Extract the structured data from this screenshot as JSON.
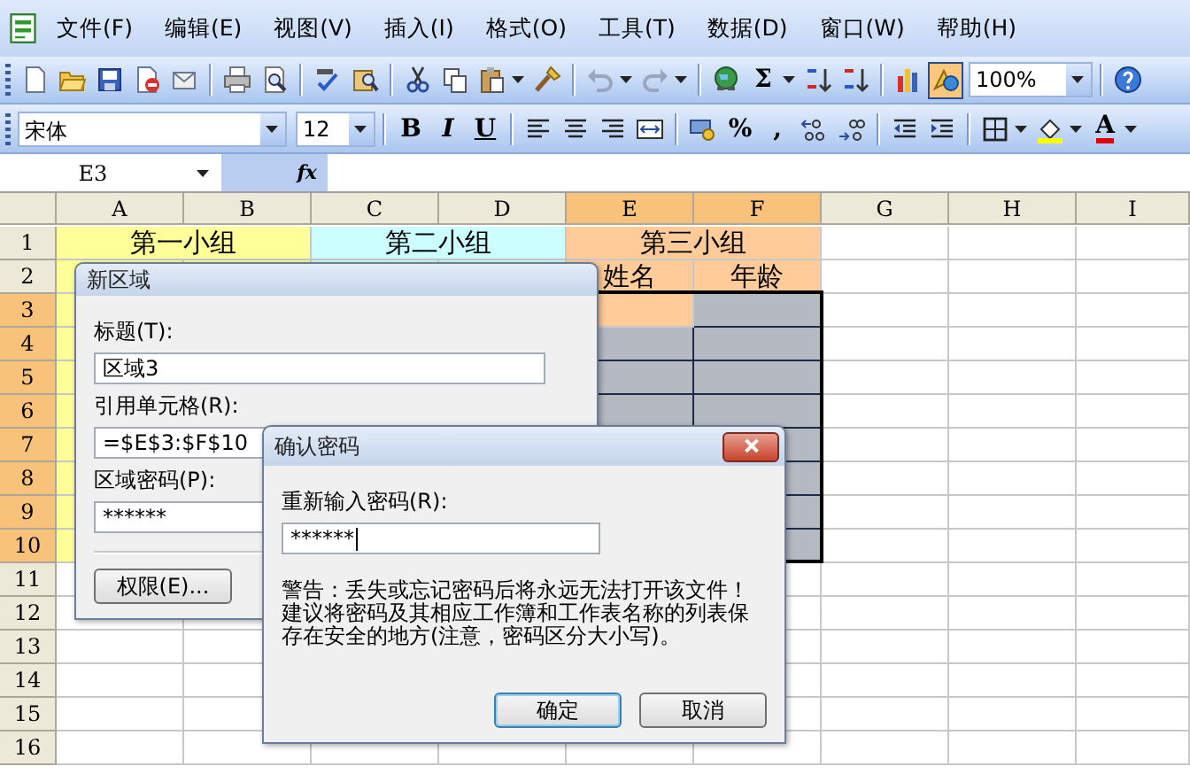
{
  "menu_bar": {
    "items": [
      {
        "label": "文件(F)"
      },
      {
        "label": "编辑(E)"
      },
      {
        "label": "视图(V)"
      },
      {
        "label": "插入(I)"
      },
      {
        "label": "格式(O)"
      },
      {
        "label": "工具(T)"
      },
      {
        "label": "数据(D)"
      },
      {
        "label": "窗口(W)"
      },
      {
        "label": "帮助(H)"
      }
    ]
  },
  "standard_toolbar": {
    "autosum": "Σ",
    "zoom": "100%",
    "drawing_on": true
  },
  "formatting_toolbar": {
    "font": "宋体",
    "size": "12",
    "bold": "B",
    "italic": "I",
    "underline": "U",
    "percent": "%",
    "comma": ",",
    "font_color_letter": "A"
  },
  "formula_bar": {
    "name_box": "E3",
    "function_label": "fx"
  },
  "sheet": {
    "columns": [
      {
        "label": "A",
        "selected": false
      },
      {
        "label": "B",
        "selected": false
      },
      {
        "label": "C",
        "selected": false
      },
      {
        "label": "D",
        "selected": false
      },
      {
        "label": "E",
        "selected": true
      },
      {
        "label": "F",
        "selected": true
      },
      {
        "label": "G",
        "selected": false
      },
      {
        "label": "H",
        "selected": false
      },
      {
        "label": "I",
        "selected": false
      }
    ],
    "rows": [
      {
        "label": "1",
        "selected": false,
        "in_table": true
      },
      {
        "label": "2",
        "selected": false,
        "in_table": true
      },
      {
        "label": "3",
        "selected": true,
        "in_table": true
      },
      {
        "label": "4",
        "selected": true,
        "in_table": true
      },
      {
        "label": "5",
        "selected": true,
        "in_table": true
      },
      {
        "label": "6",
        "selected": true,
        "in_table": true
      },
      {
        "label": "7",
        "selected": true,
        "in_table": true
      },
      {
        "label": "8",
        "selected": true,
        "in_table": true
      },
      {
        "label": "9",
        "selected": true,
        "in_table": true
      },
      {
        "label": "10",
        "selected": true,
        "in_table": true
      },
      {
        "label": "11",
        "selected": false,
        "in_table": false
      },
      {
        "label": "12",
        "selected": false,
        "in_table": false
      },
      {
        "label": "13",
        "selected": false,
        "in_table": false
      },
      {
        "label": "14",
        "selected": false,
        "in_table": false
      },
      {
        "label": "15",
        "selected": false,
        "in_table": false
      },
      {
        "label": "16",
        "selected": false,
        "in_table": false
      }
    ],
    "groups": [
      {
        "title": "第一小组",
        "color": "#ffff99"
      },
      {
        "title": "第二小组",
        "color": "#ccffff"
      },
      {
        "title": "第三小组",
        "color": "#ffcc99",
        "subheaders": [
          "姓名",
          "年龄"
        ]
      }
    ]
  },
  "new_range_dialog": {
    "title": "新区域",
    "closable": false,
    "fields": [
      {
        "label": "标题(T):",
        "value": "区域3",
        "kind": "text",
        "focused": false
      },
      {
        "label": "引用单元格(R):",
        "value": "=$E$3:$F$10",
        "kind": "range",
        "focused": false
      },
      {
        "label": "区域密码(P):",
        "value": "******",
        "kind": "password",
        "focused": false
      }
    ],
    "buttons": [
      "权限(E)..."
    ]
  },
  "confirm_password_dialog": {
    "title": "确认密码",
    "closable": true,
    "fields": [
      {
        "label": "重新输入密码(R):",
        "value": "******",
        "kind": "password",
        "focused": true
      }
    ],
    "warning": "警告：丢失或忘记密码后将永远无法打开该文件！建议将密码及其相应工作簿和工作表名称的列表保存在安全的地方(注意，密码区分大小写)。",
    "buttons": [
      {
        "label": "确定",
        "default": true
      },
      {
        "label": "取消",
        "default": false
      }
    ]
  }
}
